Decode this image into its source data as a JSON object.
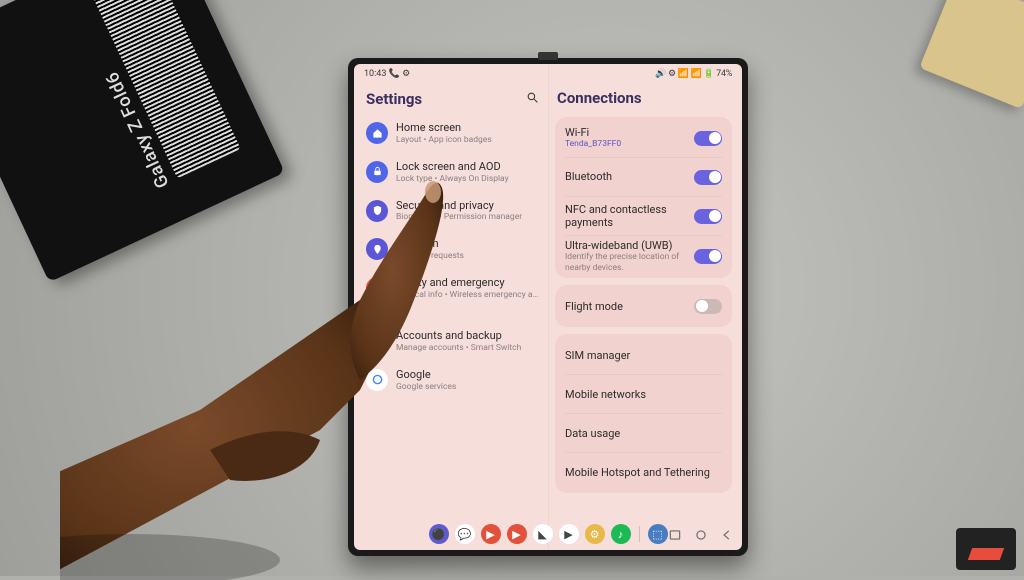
{
  "product_box_text": "Galaxy Z Fold6",
  "statusbar": {
    "time": "10:43",
    "icons_left": "📞 ⚙",
    "right": "🔊 ⚙ 📶 📶 🔋 74%"
  },
  "left_pane": {
    "title": "Settings",
    "items": [
      {
        "icon": "home",
        "color": "#4f66e8",
        "title": "Home screen",
        "sub": "Layout  •  App icon badges"
      },
      {
        "icon": "lock",
        "color": "#4f66e8",
        "title": "Lock screen and AOD",
        "sub": "Lock type  •  Always On Display"
      },
      {
        "icon": "shield",
        "color": "#5a56d6",
        "title": "Security and privacy",
        "sub": "Biometrics  •  Permission manager"
      },
      {
        "icon": "pin",
        "color": "#5a56d6",
        "title": "Location",
        "sub": "Location requests"
      },
      {
        "icon": "sos",
        "color": "#d94f46",
        "title": "Safety and emergency",
        "sub": "Medical info  •  Wireless emergency alerts"
      },
      {
        "icon": "cloud",
        "color": "#4a9ad9",
        "title": "Accounts and backup",
        "sub": "Manage accounts  •  Smart Switch"
      },
      {
        "icon": "google",
        "color": "#ffffff",
        "title": "Google",
        "sub": "Google services"
      }
    ]
  },
  "right_pane": {
    "title": "Connections",
    "group1": [
      {
        "title": "Wi-Fi",
        "sub": "Tenda_B73FF0",
        "sub_link": true,
        "toggle": "on",
        "name": "wifi"
      },
      {
        "title": "Bluetooth",
        "sub": "",
        "sub_link": false,
        "toggle": "on",
        "name": "bluetooth"
      },
      {
        "title": "NFC and contactless payments",
        "sub": "",
        "sub_link": false,
        "toggle": "on",
        "name": "nfc"
      },
      {
        "title": "Ultra-wideband (UWB)",
        "sub": "Identify the precise location of nearby devices.",
        "sub_link": false,
        "toggle": "on",
        "name": "uwb"
      }
    ],
    "group2": [
      {
        "title": "Flight mode",
        "sub": "",
        "toggle": "off",
        "name": "flight-mode"
      }
    ],
    "group3": [
      {
        "title": "SIM manager",
        "name": "sim-manager"
      },
      {
        "title": "Mobile networks",
        "name": "mobile-networks"
      },
      {
        "title": "Data usage",
        "name": "data-usage"
      },
      {
        "title": "Mobile Hotspot and Tethering",
        "name": "hotspot"
      }
    ]
  },
  "taskbar": {
    "apps": [
      {
        "bg": "#5f5ad1",
        "glyph": "⚫",
        "name": "finder"
      },
      {
        "bg": "#ffffff",
        "glyph": "💬",
        "name": "messages"
      },
      {
        "bg": "#e2513c",
        "glyph": "▶",
        "name": "youtube-music"
      },
      {
        "bg": "#e2513c",
        "glyph": "▶",
        "name": "youtube"
      },
      {
        "bg": "#ffffff",
        "glyph": "◣",
        "name": "gallery"
      },
      {
        "bg": "#ffffff",
        "glyph": "▶",
        "name": "play-store"
      },
      {
        "bg": "#e8b84a",
        "glyph": "⚙",
        "name": "settings"
      },
      {
        "bg": "#1db954",
        "glyph": "♪",
        "name": "spotify"
      },
      {
        "bg": "#4a7cc2",
        "glyph": "⬚",
        "name": "quick-panel"
      }
    ]
  }
}
